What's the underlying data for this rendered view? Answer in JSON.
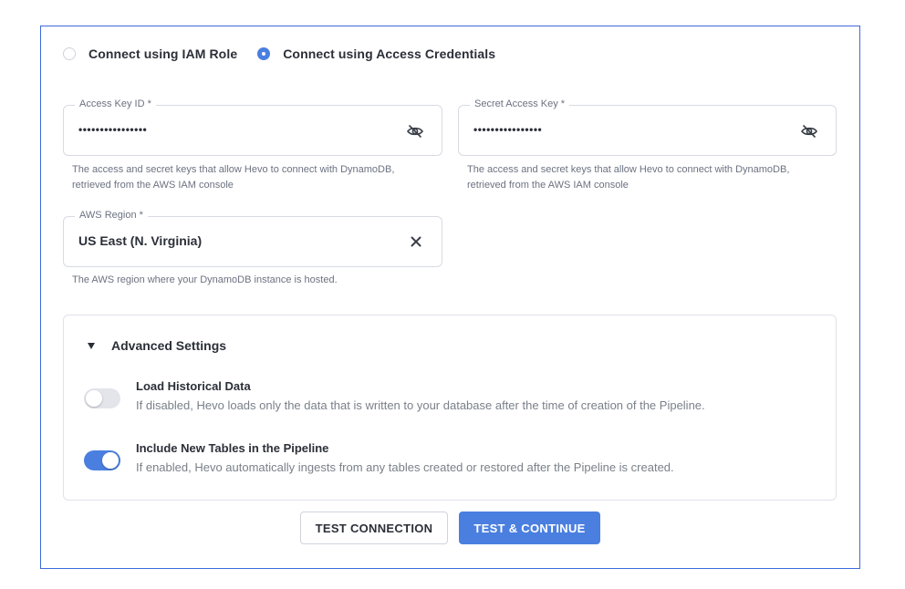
{
  "connection_mode": {
    "options": [
      {
        "label": "Connect using IAM Role",
        "selected": false
      },
      {
        "label": "Connect using Access Credentials",
        "selected": true
      }
    ]
  },
  "fields": {
    "access_key": {
      "label": "Access Key ID *",
      "value": "••••••••••••••••",
      "hint_line1": "The access and secret keys that allow Hevo to connect with DynamoDB,",
      "hint_line2": "retrieved from the AWS IAM console",
      "icon": "eye-slash-icon"
    },
    "secret_key": {
      "label": "Secret Access Key *",
      "value": "••••••••••••••••",
      "hint_line1": "The access and secret keys that allow Hevo to connect with DynamoDB,",
      "hint_line2": "retrieved from the AWS IAM console",
      "icon": "eye-slash-icon"
    },
    "region": {
      "label": "AWS Region *",
      "value": "US East (N. Virginia)",
      "hint": "The AWS region where your DynamoDB instance is hosted.",
      "icon": "close-icon"
    }
  },
  "advanced": {
    "title": "Advanced Settings",
    "expanded": true,
    "options": [
      {
        "title": "Load Historical Data",
        "description": "If disabled, Hevo loads only the data that is written to your database after the time of creation of the Pipeline.",
        "enabled": false
      },
      {
        "title": "Include New Tables in the Pipeline",
        "description": "If enabled, Hevo automatically ingests from any tables created or restored after the Pipeline is created.",
        "enabled": true
      }
    ]
  },
  "buttons": {
    "test_connection": "TEST CONNECTION",
    "test_continue": "TEST & CONTINUE"
  },
  "colors": {
    "accent": "#4a7fe0",
    "panel_border": "#3c6ad9",
    "text": "#2b2f38",
    "muted": "#6b7280"
  }
}
